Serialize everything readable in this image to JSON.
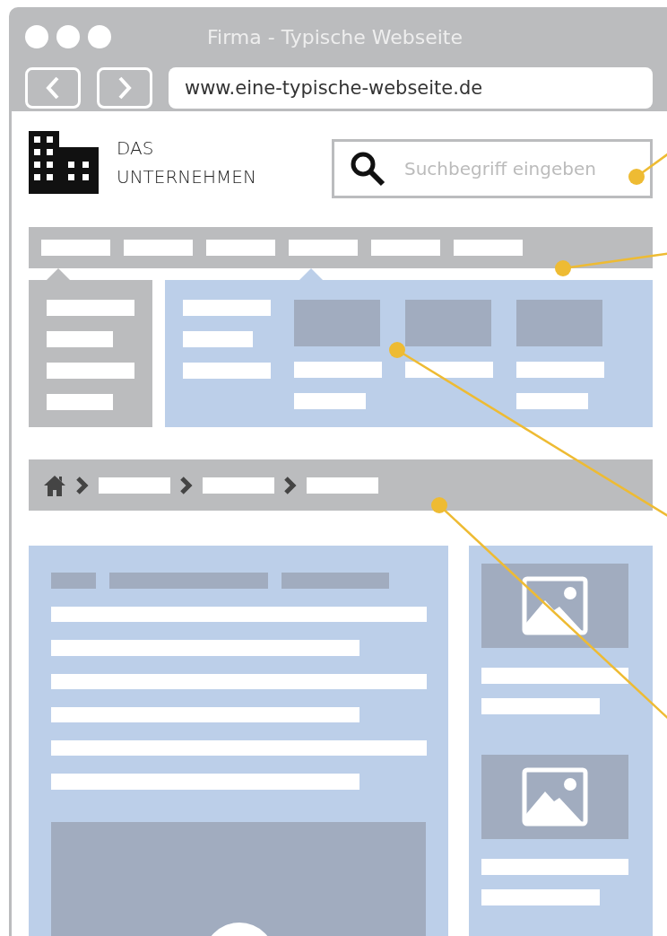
{
  "window": {
    "title": "Firma - Typische Webseite"
  },
  "address_bar": {
    "value": "www.eine-typische-webseite.de"
  },
  "logo": {
    "lines": [
      "DAS",
      "UNTERNEHMEN"
    ]
  },
  "search": {
    "placeholder": "Suchbegriff eingeben"
  }
}
